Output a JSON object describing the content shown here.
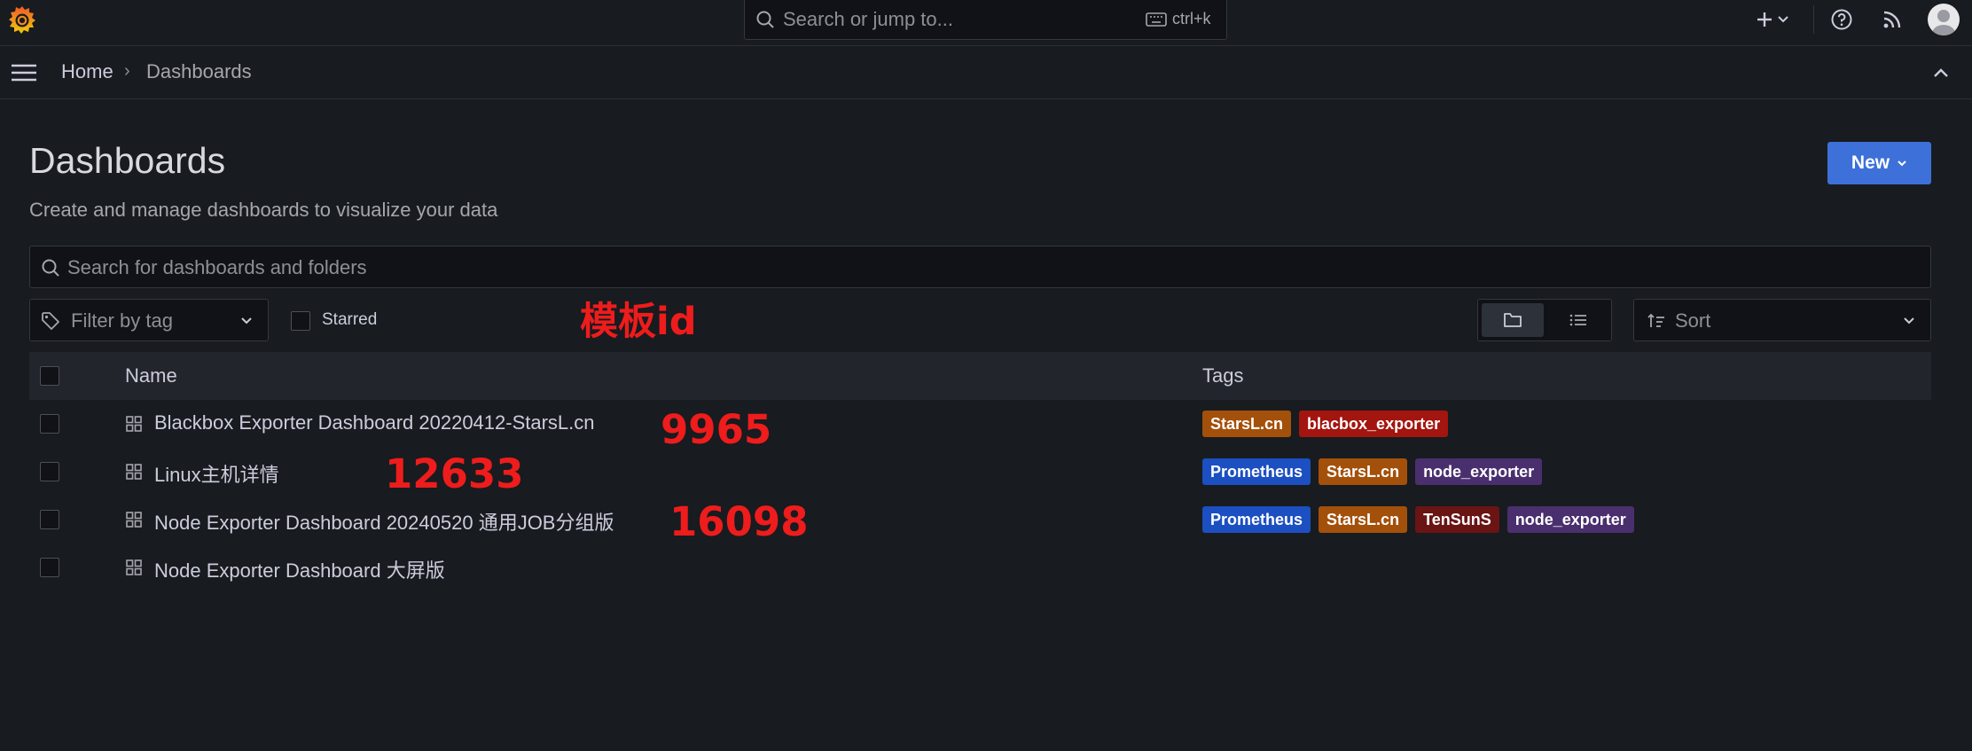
{
  "topbar": {
    "search_placeholder": "Search or jump to...",
    "shortcut": "ctrl+k"
  },
  "breadcrumb": {
    "home": "Home",
    "separator": "›",
    "current": "Dashboards"
  },
  "page": {
    "title": "Dashboards",
    "subtitle": "Create and manage dashboards to visualize your data",
    "new_button": "New"
  },
  "filters": {
    "search_placeholder": "Search for dashboards and folders",
    "tag_placeholder": "Filter by tag",
    "starred_label": "Starred",
    "sort_placeholder": "Sort"
  },
  "annotations": {
    "title": "模板id",
    "ids": [
      "9965",
      "12633",
      "16098"
    ]
  },
  "table": {
    "headers": {
      "name": "Name",
      "tags": "Tags"
    },
    "rows": [
      {
        "name": "Blackbox Exporter Dashboard 20220412-StarsL.cn",
        "tags": [
          {
            "label": "StarsL.cn",
            "color": "#a3500a"
          },
          {
            "label": "blacbox_exporter",
            "color": "#a3150f"
          }
        ]
      },
      {
        "name": "Linux主机详情",
        "tags": [
          {
            "label": "Prometheus",
            "color": "#1c4fc1"
          },
          {
            "label": "StarsL.cn",
            "color": "#a3500a"
          },
          {
            "label": "node_exporter",
            "color": "#4a2f6e"
          }
        ]
      },
      {
        "name": "Node Exporter Dashboard 20240520 通用JOB分组版",
        "tags": [
          {
            "label": "Prometheus",
            "color": "#1c4fc1"
          },
          {
            "label": "StarsL.cn",
            "color": "#a3500a"
          },
          {
            "label": "TenSunS",
            "color": "#6a1414"
          },
          {
            "label": "node_exporter",
            "color": "#4a2f6e"
          }
        ]
      },
      {
        "name": "Node Exporter Dashboard 大屏版",
        "tags": []
      }
    ]
  },
  "colors": {
    "background": "#181b1f",
    "primary": "#3d71d9",
    "annotation": "#ee1c1c"
  }
}
